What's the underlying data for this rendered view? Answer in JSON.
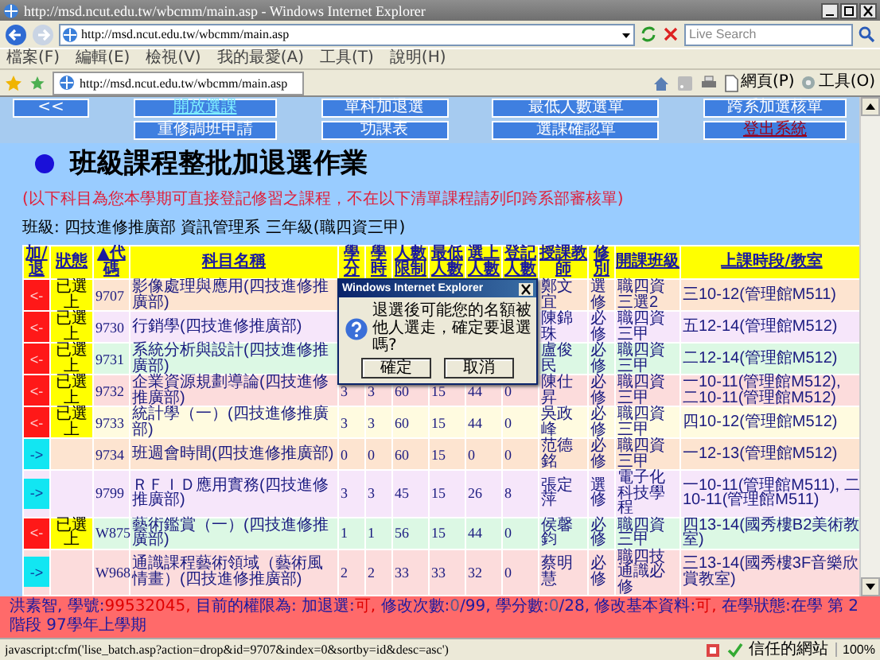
{
  "window": {
    "title": "http://msd.ncut.edu.tw/wbcmm/main.asp - Windows Internet Explorer"
  },
  "address_bar": {
    "url": "http://msd.ncut.edu.tw/wbcmm/main.asp"
  },
  "search": {
    "placeholder": "Live Search"
  },
  "menu": [
    "檔案(F)",
    "編輯(E)",
    "檢視(V)",
    "我的最愛(A)",
    "工具(T)",
    "說明(H)"
  ],
  "tab": {
    "title": "http://msd.ncut.edu.tw/wbcmm/main.asp"
  },
  "command_bar": [
    "網頁(P)",
    "工具(O)"
  ],
  "nav": [
    [
      {
        "label": "<<",
        "kind": "normal"
      },
      {
        "label": "開放選課",
        "kind": "current"
      },
      {
        "label": "單科加退選",
        "kind": "normal"
      },
      {
        "label": "最低人數選單",
        "kind": "normal"
      },
      {
        "label": "跨系加選核單",
        "kind": "normal"
      }
    ],
    [
      {
        "label": "重修調班申請",
        "kind": "normal"
      },
      {
        "label": "功課表",
        "kind": "normal"
      },
      {
        "label": "選課確認單",
        "kind": "normal"
      },
      {
        "label": "登出系統",
        "kind": "logout"
      }
    ]
  ],
  "page": {
    "title": "班級課程整批加退選作業",
    "note": "(以下科目為您本學期可直接登記修習之課程，不在以下清單課程請列印跨系部審核單)",
    "class_info": "班級: 四技進修推廣部 資訊管理系 三年級(職四資三甲)"
  },
  "table": {
    "columns": [
      "加/退",
      "狀態",
      "▲代碼",
      "科目名稱",
      "學分",
      "學時",
      "人數限制",
      "最低人數",
      "選上人數",
      "登記人數",
      "授課教師",
      "修別",
      "開課班級",
      "上課時段/教室"
    ],
    "rows": [
      {
        "action": "<-",
        "kind": "drop",
        "status": "已選上",
        "code": "9707",
        "name": "影像處理與應用(四技進修推廣部)",
        "teacher": "鄭文宜",
        "type": "選修",
        "class": "職四資三選2",
        "time": "三10-12(管理館M511)"
      },
      {
        "action": "<-",
        "kind": "drop",
        "status": "已選上",
        "code": "9730",
        "name": "行銷學(四技進修推廣部)",
        "teacher": "陳錦珠",
        "type": "必修",
        "class": "職四資三甲",
        "time": "五12-14(管理館M512)"
      },
      {
        "action": "<-",
        "kind": "drop",
        "status": "已選上",
        "code": "9731",
        "name": "系統分析與設計(四技進修推廣部)",
        "teacher": "盧俊民",
        "type": "必修",
        "class": "職四資三甲",
        "time": "二12-14(管理館M512)"
      },
      {
        "action": "<-",
        "kind": "drop",
        "status": "已選上",
        "code": "9732",
        "name": "企業資源規劃導論(四技進修推廣部)",
        "credits": "3",
        "hours": "3",
        "limit": "60",
        "minimum": "15",
        "enrolled": "44",
        "registered": "0",
        "teacher": "陳仕昇",
        "type": "必修",
        "class": "職四資三甲",
        "time": "一10-11(管理館M512), 二10-11(管理館M512)"
      },
      {
        "action": "<-",
        "kind": "drop",
        "status": "已選上",
        "code": "9733",
        "name": "統計學（一）(四技進修推廣部)",
        "credits": "3",
        "hours": "3",
        "limit": "60",
        "minimum": "15",
        "enrolled": "44",
        "registered": "0",
        "teacher": "吳政峰",
        "type": "必修",
        "class": "職四資三甲",
        "time": "四10-12(管理館M512)"
      },
      {
        "action": "->",
        "kind": "add",
        "code": "9734",
        "name": "班週會時間(四技進修推廣部)",
        "credits": "0",
        "hours": "0",
        "limit": "60",
        "minimum": "15",
        "enrolled": "0",
        "registered": "0",
        "teacher": "范德銘",
        "type": "必修",
        "class": "職四資三甲",
        "time": "一12-13(管理館M512)"
      },
      {
        "action": "->",
        "kind": "add",
        "code": "9799",
        "name": "ＲＦＩＤ應用實務(四技進修推廣部)",
        "credits": "3",
        "hours": "3",
        "limit": "45",
        "minimum": "15",
        "enrolled": "26",
        "registered": "8",
        "teacher": "張定萍",
        "type": "選修",
        "class": "電子化科技學程",
        "time": "一10-11(管理館M511), 二10-11(管理館M511)"
      },
      {
        "action": "<-",
        "kind": "drop",
        "status": "已選上",
        "code": "W875",
        "name": "藝術鑑賞（一）(四技進修推廣部)",
        "credits": "1",
        "hours": "1",
        "limit": "56",
        "minimum": "15",
        "enrolled": "44",
        "registered": "0",
        "teacher": "侯馨鈞",
        "type": "必修",
        "class": "職四資三甲",
        "time": "四13-14(國秀樓B2美術教室)"
      },
      {
        "action": "->",
        "kind": "add",
        "code": "W968",
        "name": "通識課程藝術領域（藝術風情畫）(四技進修推廣部)",
        "credits": "2",
        "hours": "2",
        "limit": "33",
        "minimum": "33",
        "enrolled": "32",
        "registered": "0",
        "teacher": "蔡明慧",
        "type": "必修",
        "class": "職四技通識必修",
        "time": "三13-14(國秀樓3F音樂欣賞教室)"
      }
    ]
  },
  "user_bar": [
    {
      "label": "洪素智,"
    },
    {
      "label": "學號:",
      "value": "99532045,"
    },
    {
      "label": "目前的權限為: 加退選:",
      "value": "可,"
    },
    {
      "label": "修改次數:",
      "value": "0",
      "tail": "/99,"
    },
    {
      "label": "學分數:",
      "value": "0",
      "tail": "/28,"
    },
    {
      "label": "修改基本資料:",
      "value": "可,"
    },
    {
      "label": "在學狀態:在學 第 2 階段 97學年上學期"
    }
  ],
  "status_bar": {
    "text": "javascript:cfm('lise_batch.asp?action=drop&id=9707&index=0&sortby=id&desc=asc')",
    "zone": "信任的網站",
    "zoom": "100%"
  },
  "dialog": {
    "title": "Windows Internet Explorer",
    "message": "退選後可能您的名額被他人選走，確定要退選嗎?",
    "buttons": [
      "確定",
      "取消"
    ]
  }
}
